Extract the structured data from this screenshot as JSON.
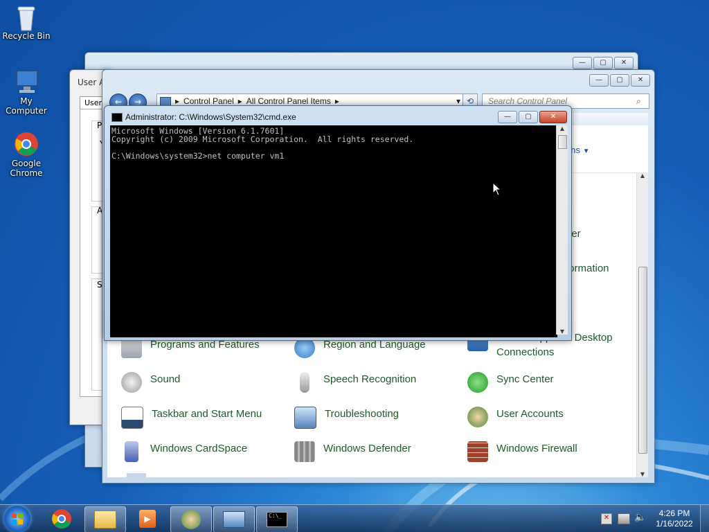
{
  "desktop": {
    "icons": [
      {
        "label": "Recycle Bin",
        "icon": "recycle-bin-icon"
      },
      {
        "label": "My Computer",
        "icon": "computer-icon"
      },
      {
        "label": "Google Chrome",
        "icon": "chrome-icon"
      }
    ]
  },
  "user_accounts_window": {
    "title": "User A",
    "tab": "Users",
    "frag_p": "P",
    "frag_y": "Y",
    "frag_a": "A",
    "frag_s": "S"
  },
  "control_panel": {
    "breadcrumb": [
      "Control Panel",
      "All Control Panel Items"
    ],
    "search_placeholder": "Search Control Panel",
    "view_by": "ons",
    "partial_labels": [
      "s",
      "her",
      "formation"
    ],
    "items": [
      {
        "label": "Programs and Features",
        "icon": "programs-icon"
      },
      {
        "label": "Region and Language",
        "icon": "globe-clock-icon"
      },
      {
        "label": "RemoteApp and Desktop Connections",
        "icon": "remote-desktop-icon"
      },
      {
        "label": "Sound",
        "icon": "speaker-icon"
      },
      {
        "label": "Speech Recognition",
        "icon": "microphone-icon"
      },
      {
        "label": "Sync Center",
        "icon": "sync-icon"
      },
      {
        "label": "Taskbar and Start Menu",
        "icon": "taskbar-icon"
      },
      {
        "label": "Troubleshooting",
        "icon": "troubleshoot-icon"
      },
      {
        "label": "User Accounts",
        "icon": "users-icon"
      },
      {
        "label": "Windows CardSpace",
        "icon": "cardspace-icon"
      },
      {
        "label": "Windows Defender",
        "icon": "defender-icon"
      },
      {
        "label": "Windows Firewall",
        "icon": "firewall-icon"
      }
    ]
  },
  "cmd": {
    "title": "Administrator: C:\\Windows\\System32\\cmd.exe",
    "lines": [
      "Microsoft Windows [Version 6.1.7601]",
      "Copyright (c) 2009 Microsoft Corporation.  All rights reserved.",
      "",
      "C:\\Windows\\system32>net computer vm1"
    ]
  },
  "taskbar": {
    "time": "4:26 PM",
    "date": "1/16/2022",
    "apps": [
      "chrome",
      "explorer",
      "media-player",
      "user-accounts",
      "control-panel",
      "cmd"
    ]
  },
  "colors": {
    "cp_link_green": "#1e5a2a",
    "cmd_bg": "#000000",
    "cmd_fg": "#c0c0c0"
  }
}
